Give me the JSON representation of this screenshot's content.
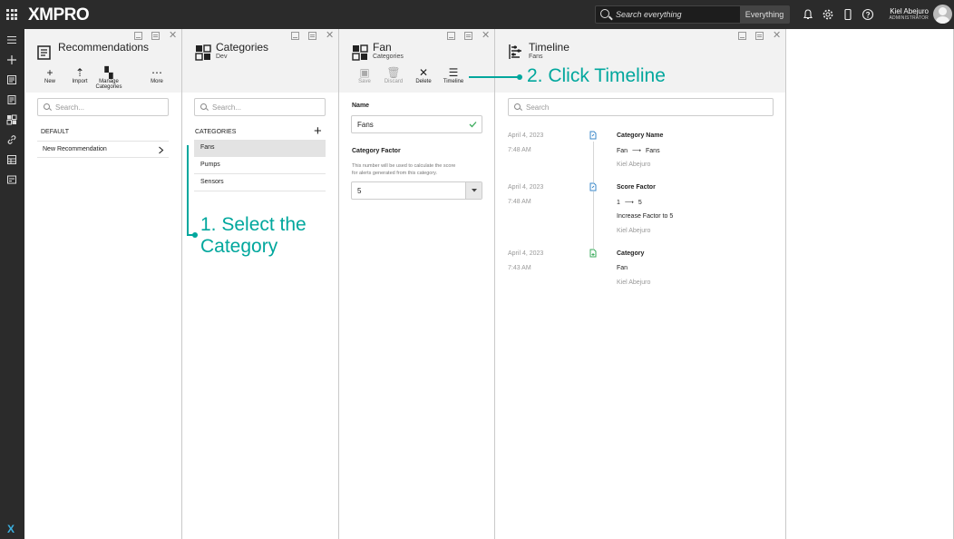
{
  "topbar": {
    "logo": "XMPRO",
    "search_placeholder": "Search everything",
    "search_scope": "Everything",
    "user_name": "Kiel Abejuro",
    "user_role": "ADMINISTRATOR"
  },
  "recommendations": {
    "title": "Recommendations",
    "toolbar": {
      "new": "New",
      "import": "Import",
      "manage_line1": "Manage",
      "manage_line2": "Categories",
      "more": "More"
    },
    "search_placeholder": "Search...",
    "group_label": "DEFAULT",
    "items": [
      "New Recommendation"
    ]
  },
  "categories": {
    "title": "Categories",
    "subtitle": "Dev",
    "search_placeholder": "Search...",
    "section_label": "CATEGORIES",
    "items": [
      "Fans",
      "Pumps",
      "Sensors"
    ]
  },
  "fan": {
    "title": "Fan",
    "subtitle": "Categories",
    "toolbar": {
      "save": "Save",
      "discard": "Discard",
      "delete": "Delete",
      "timeline": "Timeline"
    },
    "name_label": "Name",
    "name_value": "Fans",
    "factor_label": "Category Factor",
    "factor_help_line1": "This number will be used to calculate the score",
    "factor_help_line2": "for alerts generated from this category.",
    "factor_value": "5"
  },
  "timeline": {
    "title": "Timeline",
    "subtitle": "Fans",
    "search_placeholder": "Search",
    "entries": [
      {
        "date": "April 4, 2023",
        "time": "7:48 AM",
        "heading": "Category Name",
        "from": "Fan",
        "to": "Fans",
        "extra": "",
        "user": "Kiel Abejuro"
      },
      {
        "date": "April 4, 2023",
        "time": "7:48 AM",
        "heading": "Score Factor",
        "from": "1",
        "to": "5",
        "extra": "Increase Factor to 5",
        "user": "Kiel Abejuro"
      },
      {
        "date": "April 4, 2023",
        "time": "7:43 AM",
        "heading": "Category",
        "from": "Fan",
        "to": "",
        "extra": "",
        "user": "Kiel Abejuro"
      }
    ]
  },
  "annotations": {
    "step1_line1": "1. Select the",
    "step1_line2": "Category",
    "step2": "2. Click Timeline"
  },
  "colors": {
    "accent": "#00a79d",
    "topbar": "#2b2b2b",
    "selected_row": "#e3e3e3",
    "check": "#3bab5c",
    "file_icon_blue": "#3a87c8",
    "file_icon_green": "#3bab5c"
  }
}
